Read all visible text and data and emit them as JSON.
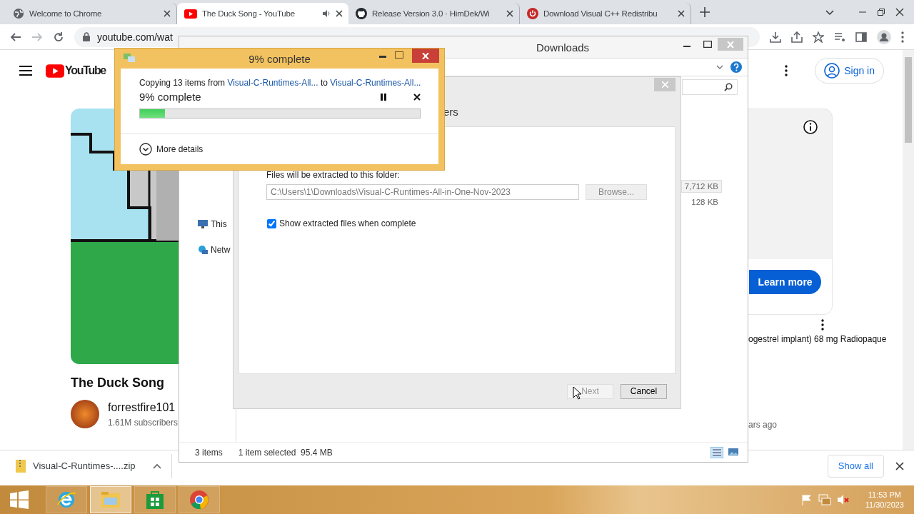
{
  "browser": {
    "tabs": [
      {
        "title": "Welcome to Chrome",
        "kind": "globe",
        "selected": false,
        "audio": false
      },
      {
        "title": "The Duck Song - YouTube",
        "kind": "youtube",
        "selected": true,
        "audio": true
      },
      {
        "title": "Release Version 3.0 · HimDek/Wi",
        "kind": "github",
        "selected": false,
        "audio": false
      },
      {
        "title": "Download Visual C++ Redistribu",
        "kind": "power",
        "selected": false,
        "audio": false
      }
    ],
    "address": "youtube.com/wat"
  },
  "youtube": {
    "logo": "YouTube",
    "sign_in": "Sign in",
    "video": {
      "kind": "picture",
      "title": "The Duck Song",
      "channel": "forrestfire101",
      "subscribers": "1.61M subscribers"
    },
    "ad": {
      "button": "Learn more",
      "description": "ogestrel implant) 68 mg Radiopaque",
      "age": "ars ago"
    }
  },
  "download_shelf": {
    "file": "Visual-C-Runtimes-....zip",
    "show_all": "Show all"
  },
  "explorer": {
    "title": "Downloads",
    "nav": [
      {
        "label": "This",
        "kind": "pc"
      },
      {
        "label": "Netw",
        "kind": "network"
      }
    ],
    "sizes": [
      {
        "text": "7,712 KB",
        "selected": true
      },
      {
        "text": "128 KB",
        "selected": false
      }
    ],
    "status": {
      "count": "3 items",
      "selection": "1 item selected  95.4 MB"
    }
  },
  "wizard": {
    "heading": "ers",
    "folder_label": "Files will be extracted to this folder:",
    "path": "C:\\Users\\1\\Downloads\\Visual-C-Runtimes-All-in-One-Nov-2023",
    "browse": "Browse...",
    "show_files": {
      "label": "Show extracted files when complete",
      "checked": true
    },
    "buttons": [
      {
        "label": "Next",
        "disabled": true
      },
      {
        "label": "Cancel",
        "disabled": false
      }
    ]
  },
  "copy_dialog": {
    "title": "9% complete",
    "prefix": "Copying 13 items from",
    "source": "Visual-C-Runtimes-All...",
    "joiner": "to",
    "target": "Visual-C-Runtimes-All...",
    "status": "9% complete",
    "level": 0.09,
    "more": "More details"
  },
  "taskbar": {
    "apps": [
      {
        "kind": "ie",
        "selected": false
      },
      {
        "kind": "explorer",
        "selected": true
      },
      {
        "kind": "store",
        "selected": false
      },
      {
        "kind": "chrome",
        "selected": false
      }
    ],
    "time": "11:53 PM",
    "date": "11/30/2023"
  }
}
